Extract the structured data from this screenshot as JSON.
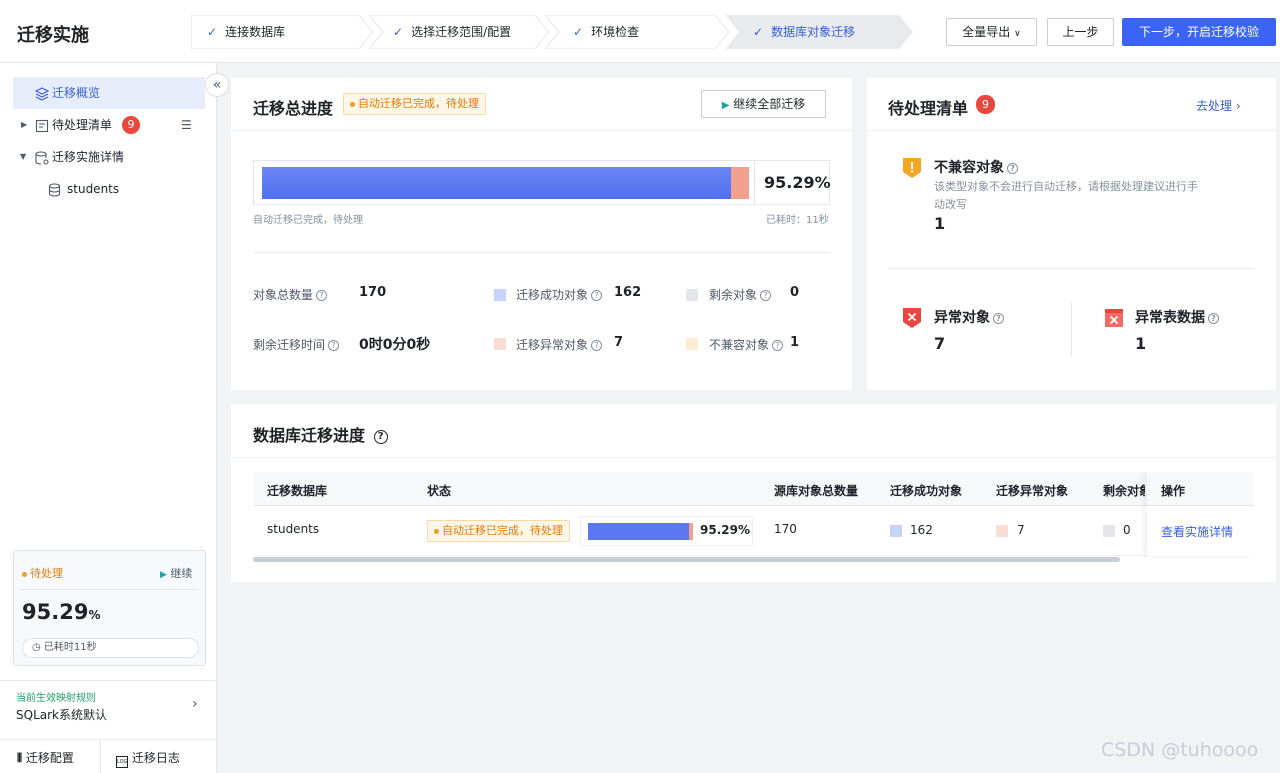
{
  "header": {
    "title": "迁移实施",
    "steps": [
      {
        "label": "连接数据库"
      },
      {
        "label": "选择迁移范围/配置"
      },
      {
        "label": "环境检查"
      },
      {
        "label": "数据库对象迁移"
      }
    ],
    "export_label": "全量导出",
    "prev_label": "上一步",
    "next_label": "下一步，开启迁移校验"
  },
  "sidebar": {
    "overview": "迁移概览",
    "pending": "待处理清单",
    "pending_count": "9",
    "details": "迁移实施详情",
    "db": "students",
    "status_card": {
      "status": "待处理",
      "continue": "继续",
      "percent": "95.29",
      "percent_unit": "%",
      "elapsed": "已耗时11秒"
    },
    "rule_label": "当前生效映射规则",
    "rule_value": "SQLark系统默认",
    "config": "迁移配置",
    "log": "迁移日志"
  },
  "progress": {
    "title": "迁移总进度",
    "tag": "自动迁移已完成，待处理",
    "continue_all": "继续全部迁移",
    "percent_text": "95.29%",
    "success_fraction": 0.9529,
    "error_fraction": 0.0412,
    "status_text": "自动迁移已完成，待处理",
    "elapsed": "已耗时：11秒",
    "stats": {
      "total_label": "对象总数量",
      "total": "170",
      "success_label": "迁移成功对象",
      "success": "162",
      "remain_label": "剩余对象",
      "remain": "0",
      "time_label": "剩余迁移时间",
      "time": "0时0分0秒",
      "error_label": "迁移异常对象",
      "error": "7",
      "incompat_label": "不兼容对象",
      "incompat": "1"
    }
  },
  "todo": {
    "title": "待处理清单",
    "count": "9",
    "link": "去处理",
    "incompat_title": "不兼容对象",
    "incompat_desc_1": "该类型对象不会进行自动迁移，请根据处理建议进行手",
    "incompat_desc_2": "动改写",
    "incompat_count": "1",
    "error_title": "异常对象",
    "error_count": "7",
    "table_error_title": "异常表数据",
    "table_error_count": "1"
  },
  "dbprogress": {
    "title": "数据库迁移进度",
    "columns": [
      "迁移数据库",
      "状态",
      "源库对象总数量",
      "迁移成功对象",
      "迁移异常对象",
      "剩余对象",
      "操作"
    ],
    "row": {
      "db": "students",
      "status": "自动迁移已完成，待处理",
      "percent": "95.29%",
      "total": "170",
      "success": "162",
      "error": "7",
      "remain": "0",
      "action": "查看实施详情"
    }
  },
  "watermark": "CSDN @tuhoooo"
}
